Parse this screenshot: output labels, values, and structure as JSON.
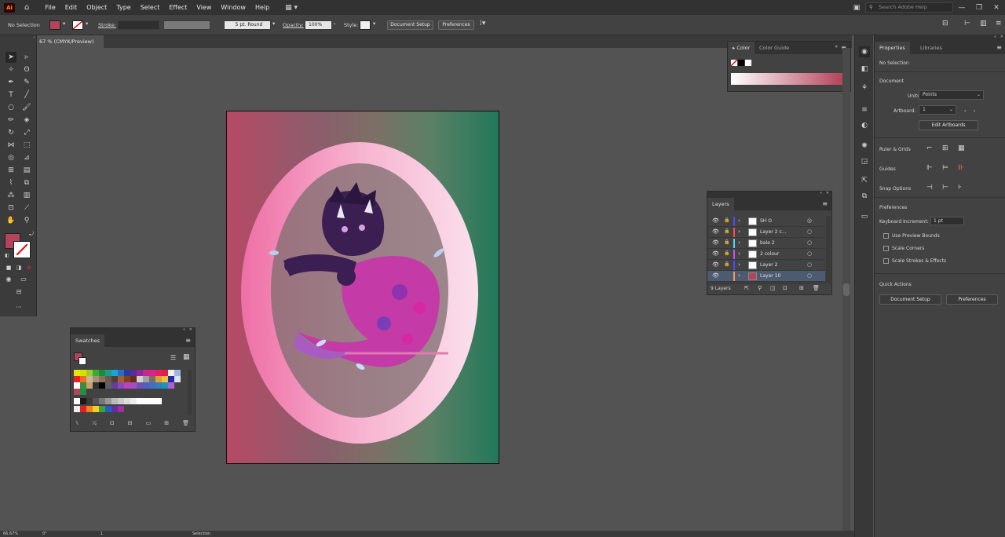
{
  "app": {
    "logo": "Ai",
    "home_icon": "home-icon"
  },
  "menu": [
    "File",
    "Edit",
    "Object",
    "Type",
    "Select",
    "Effect",
    "View",
    "Window",
    "Help"
  ],
  "search": {
    "placeholder": "Search Adobe Help"
  },
  "control": {
    "selection": "No Selection",
    "stroke_label": "Stroke:",
    "stroke_profile": "5 pt. Round",
    "opacity_label": "Opacity:",
    "opacity_value": "100%",
    "style_label": "Style:",
    "document_setup": "Document Setup",
    "preferences": "Preferences",
    "fill_color": "#b4445c"
  },
  "document": {
    "tab": "67 % (CMYK/Preview)"
  },
  "color_panel": {
    "tabs": [
      "Color",
      "Color Guide"
    ]
  },
  "swatches_panel": {
    "title": "Swatches"
  },
  "layers_panel": {
    "title": "Layers",
    "layers": [
      {
        "name": "SH O",
        "color": "#4d4dff",
        "selected": false
      },
      {
        "name": "Layer 2 c...",
        "color": "#ff4d4d",
        "selected": false
      },
      {
        "name": "bale 2",
        "color": "#4dd9ff",
        "selected": false
      },
      {
        "name": "2 colour",
        "color": "#c94dff",
        "selected": false
      },
      {
        "name": "Layer 2",
        "color": "#4d4dff",
        "selected": false
      },
      {
        "name": "Layer 10",
        "color": "#ff9a4d",
        "selected": true
      }
    ],
    "count": "9 Layers"
  },
  "properties": {
    "tabs": [
      "Properties",
      "Libraries"
    ],
    "no_selection": "No Selection",
    "document_heading": "Document",
    "units_label": "Units:",
    "units_value": "Points",
    "artboard_label": "Artboard:",
    "artboard_value": "1",
    "edit_artboards": "Edit Artboards",
    "rulers_grids": "Ruler & Grids",
    "guides": "Guides",
    "snap_options": "Snap Options",
    "preferences_heading": "Preferences",
    "keyboard_increment_label": "Keyboard Increment:",
    "keyboard_increment_value": "1 pt",
    "use_preview_bounds": "Use Preview Bounds",
    "scale_corners": "Scale Corners",
    "scale_strokes_effects": "Scale Strokes & Effects",
    "quick_actions": "Quick Actions",
    "document_setup": "Document Setup",
    "preferences": "Preferences"
  },
  "status": {
    "zoom": "66.67%",
    "angle": "0°",
    "artboard": "1",
    "tool": "Selection"
  }
}
